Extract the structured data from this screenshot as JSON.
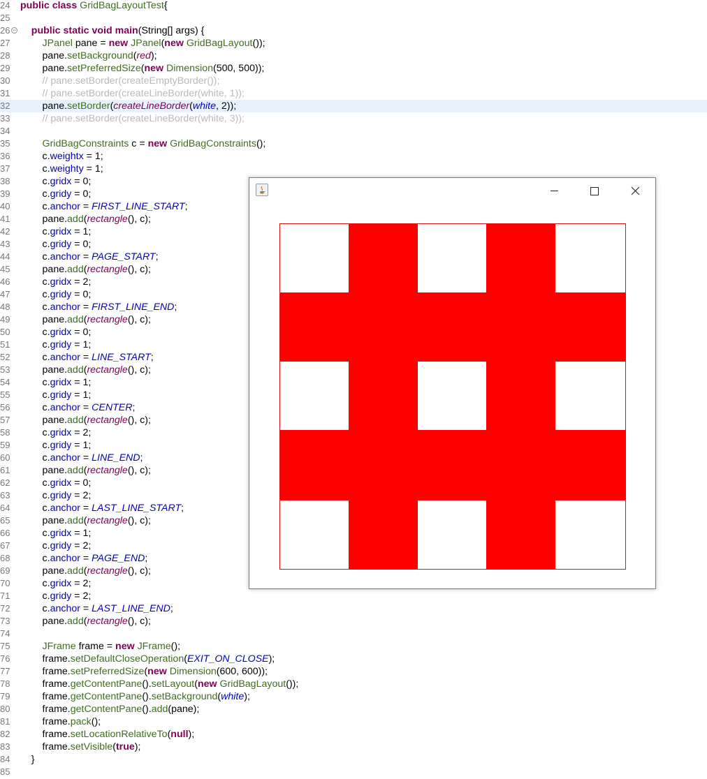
{
  "editor": {
    "lines": [
      {
        "n": "24",
        "t": [
          [
            "kw",
            "public class "
          ],
          [
            "ty",
            "GridBagLayoutTest"
          ],
          [
            "",
            "{"
          ]
        ]
      },
      {
        "n": "25",
        "t": []
      },
      {
        "n": "26",
        "fold": true,
        "t": [
          [
            "",
            "    "
          ],
          [
            "kw",
            "public static void "
          ],
          [
            "kw",
            "main"
          ],
          [
            "",
            "(String[] args) {"
          ]
        ]
      },
      {
        "n": "27",
        "t": [
          [
            "",
            "        "
          ],
          [
            "ty",
            "JPanel"
          ],
          [
            "",
            " pane = "
          ],
          [
            "kw",
            "new "
          ],
          [
            "ty",
            "JPanel"
          ],
          [
            "",
            "("
          ],
          [
            "kw",
            "new "
          ],
          [
            "ty",
            "GridBagLayout"
          ],
          [
            "",
            "());"
          ]
        ]
      },
      {
        "n": "28",
        "t": [
          [
            "",
            "        pane."
          ],
          [
            "me",
            "setBackground"
          ],
          [
            "",
            "("
          ],
          [
            "im",
            "red"
          ],
          [
            "",
            ");"
          ]
        ]
      },
      {
        "n": "29",
        "t": [
          [
            "",
            "        pane."
          ],
          [
            "me",
            "setPreferredSize"
          ],
          [
            "",
            "("
          ],
          [
            "kw",
            "new "
          ],
          [
            "ty",
            "Dimension"
          ],
          [
            "",
            "(500, 500));"
          ]
        ]
      },
      {
        "n": "30",
        "t": [
          [
            "cm",
            "        // pane.setBorder(createEmptyBorder());"
          ]
        ]
      },
      {
        "n": "31",
        "t": [
          [
            "cm",
            "        // pane.setBorder(createLineBorder(white, 1));"
          ]
        ]
      },
      {
        "n": "32",
        "current": true,
        "t": [
          [
            "",
            "        pane."
          ],
          [
            "me",
            "setBorder"
          ],
          [
            "",
            "("
          ],
          [
            "im",
            "createLineBorder"
          ],
          [
            "",
            "("
          ],
          [
            "it",
            "white"
          ],
          [
            "",
            ", 2));"
          ]
        ]
      },
      {
        "n": "33",
        "t": [
          [
            "cm",
            "        // pane.setBorder(createLineBorder(white, 3));"
          ]
        ]
      },
      {
        "n": "34",
        "t": []
      },
      {
        "n": "35",
        "t": [
          [
            "",
            "        "
          ],
          [
            "ty",
            "GridBagConstraints"
          ],
          [
            "",
            " c = "
          ],
          [
            "kw",
            "new "
          ],
          [
            "ty",
            "GridBagConstraints"
          ],
          [
            "",
            "();"
          ]
        ]
      },
      {
        "n": "36",
        "t": [
          [
            "",
            "        c."
          ],
          [
            "fi",
            "weightx"
          ],
          [
            "",
            " = 1;"
          ]
        ]
      },
      {
        "n": "37",
        "t": [
          [
            "",
            "        c."
          ],
          [
            "fi",
            "weighty"
          ],
          [
            "",
            " = 1;"
          ]
        ]
      },
      {
        "n": "38",
        "t": [
          [
            "",
            "        c."
          ],
          [
            "fi",
            "gridx"
          ],
          [
            "",
            " = 0;"
          ]
        ]
      },
      {
        "n": "39",
        "t": [
          [
            "",
            "        c."
          ],
          [
            "fi",
            "gridy"
          ],
          [
            "",
            " = 0;"
          ]
        ]
      },
      {
        "n": "40",
        "t": [
          [
            "",
            "        c."
          ],
          [
            "fi",
            "anchor"
          ],
          [
            "",
            " = "
          ],
          [
            "it",
            "FIRST_LINE_START"
          ],
          [
            "",
            ";"
          ]
        ]
      },
      {
        "n": "41",
        "t": [
          [
            "",
            "        pane."
          ],
          [
            "me",
            "add"
          ],
          [
            "",
            "("
          ],
          [
            "im",
            "rectangle"
          ],
          [
            "",
            "(), c);"
          ]
        ]
      },
      {
        "n": "42",
        "t": [
          [
            "",
            "        c."
          ],
          [
            "fi",
            "gridx"
          ],
          [
            "",
            " = 1;"
          ]
        ]
      },
      {
        "n": "43",
        "t": [
          [
            "",
            "        c."
          ],
          [
            "fi",
            "gridy"
          ],
          [
            "",
            " = 0;"
          ]
        ]
      },
      {
        "n": "44",
        "t": [
          [
            "",
            "        c."
          ],
          [
            "fi",
            "anchor"
          ],
          [
            "",
            " = "
          ],
          [
            "it",
            "PAGE_START"
          ],
          [
            "",
            ";"
          ]
        ]
      },
      {
        "n": "45",
        "t": [
          [
            "",
            "        pane."
          ],
          [
            "me",
            "add"
          ],
          [
            "",
            "("
          ],
          [
            "im",
            "rectangle"
          ],
          [
            "",
            "(), c);"
          ]
        ]
      },
      {
        "n": "46",
        "t": [
          [
            "",
            "        c."
          ],
          [
            "fi",
            "gridx"
          ],
          [
            "",
            " = 2;"
          ]
        ]
      },
      {
        "n": "47",
        "t": [
          [
            "",
            "        c."
          ],
          [
            "fi",
            "gridy"
          ],
          [
            "",
            " = 0;"
          ]
        ]
      },
      {
        "n": "48",
        "t": [
          [
            "",
            "        c."
          ],
          [
            "fi",
            "anchor"
          ],
          [
            "",
            " = "
          ],
          [
            "it",
            "FIRST_LINE_END"
          ],
          [
            "",
            ";"
          ]
        ]
      },
      {
        "n": "49",
        "t": [
          [
            "",
            "        pane."
          ],
          [
            "me",
            "add"
          ],
          [
            "",
            "("
          ],
          [
            "im",
            "rectangle"
          ],
          [
            "",
            "(), c);"
          ]
        ]
      },
      {
        "n": "50",
        "t": [
          [
            "",
            "        c."
          ],
          [
            "fi",
            "gridx"
          ],
          [
            "",
            " = 0;"
          ]
        ]
      },
      {
        "n": "51",
        "t": [
          [
            "",
            "        c."
          ],
          [
            "fi",
            "gridy"
          ],
          [
            "",
            " = 1;"
          ]
        ]
      },
      {
        "n": "52",
        "t": [
          [
            "",
            "        c."
          ],
          [
            "fi",
            "anchor"
          ],
          [
            "",
            " = "
          ],
          [
            "it",
            "LINE_START"
          ],
          [
            "",
            ";"
          ]
        ]
      },
      {
        "n": "53",
        "t": [
          [
            "",
            "        pane."
          ],
          [
            "me",
            "add"
          ],
          [
            "",
            "("
          ],
          [
            "im",
            "rectangle"
          ],
          [
            "",
            "(), c);"
          ]
        ]
      },
      {
        "n": "54",
        "t": [
          [
            "",
            "        c."
          ],
          [
            "fi",
            "gridx"
          ],
          [
            "",
            " = 1;"
          ]
        ]
      },
      {
        "n": "55",
        "t": [
          [
            "",
            "        c."
          ],
          [
            "fi",
            "gridy"
          ],
          [
            "",
            " = 1;"
          ]
        ]
      },
      {
        "n": "56",
        "t": [
          [
            "",
            "        c."
          ],
          [
            "fi",
            "anchor"
          ],
          [
            "",
            " = "
          ],
          [
            "it",
            "CENTER"
          ],
          [
            "",
            ";"
          ]
        ]
      },
      {
        "n": "57",
        "t": [
          [
            "",
            "        pane."
          ],
          [
            "me",
            "add"
          ],
          [
            "",
            "("
          ],
          [
            "im",
            "rectangle"
          ],
          [
            "",
            "(), c);"
          ]
        ]
      },
      {
        "n": "58",
        "t": [
          [
            "",
            "        c."
          ],
          [
            "fi",
            "gridx"
          ],
          [
            "",
            " = 2;"
          ]
        ]
      },
      {
        "n": "59",
        "t": [
          [
            "",
            "        c."
          ],
          [
            "fi",
            "gridy"
          ],
          [
            "",
            " = 1;"
          ]
        ]
      },
      {
        "n": "60",
        "t": [
          [
            "",
            "        c."
          ],
          [
            "fi",
            "anchor"
          ],
          [
            "",
            " = "
          ],
          [
            "it",
            "LINE_END"
          ],
          [
            "",
            ";"
          ]
        ]
      },
      {
        "n": "61",
        "t": [
          [
            "",
            "        pane."
          ],
          [
            "me",
            "add"
          ],
          [
            "",
            "("
          ],
          [
            "im",
            "rectangle"
          ],
          [
            "",
            "(), c);"
          ]
        ]
      },
      {
        "n": "62",
        "t": [
          [
            "",
            "        c."
          ],
          [
            "fi",
            "gridx"
          ],
          [
            "",
            " = 0;"
          ]
        ]
      },
      {
        "n": "63",
        "t": [
          [
            "",
            "        c."
          ],
          [
            "fi",
            "gridy"
          ],
          [
            "",
            " = 2;"
          ]
        ]
      },
      {
        "n": "64",
        "t": [
          [
            "",
            "        c."
          ],
          [
            "fi",
            "anchor"
          ],
          [
            "",
            " = "
          ],
          [
            "it",
            "LAST_LINE_START"
          ],
          [
            "",
            ";"
          ]
        ]
      },
      {
        "n": "65",
        "t": [
          [
            "",
            "        pane."
          ],
          [
            "me",
            "add"
          ],
          [
            "",
            "("
          ],
          [
            "im",
            "rectangle"
          ],
          [
            "",
            "(), c);"
          ]
        ]
      },
      {
        "n": "66",
        "t": [
          [
            "",
            "        c."
          ],
          [
            "fi",
            "gridx"
          ],
          [
            "",
            " = 1;"
          ]
        ]
      },
      {
        "n": "67",
        "t": [
          [
            "",
            "        c."
          ],
          [
            "fi",
            "gridy"
          ],
          [
            "",
            " = 2;"
          ]
        ]
      },
      {
        "n": "68",
        "t": [
          [
            "",
            "        c."
          ],
          [
            "fi",
            "anchor"
          ],
          [
            "",
            " = "
          ],
          [
            "it",
            "PAGE_END"
          ],
          [
            "",
            ";"
          ]
        ]
      },
      {
        "n": "69",
        "t": [
          [
            "",
            "        pane."
          ],
          [
            "me",
            "add"
          ],
          [
            "",
            "("
          ],
          [
            "im",
            "rectangle"
          ],
          [
            "",
            "(), c);"
          ]
        ]
      },
      {
        "n": "70",
        "t": [
          [
            "",
            "        c."
          ],
          [
            "fi",
            "gridx"
          ],
          [
            "",
            " = 2;"
          ]
        ]
      },
      {
        "n": "71",
        "t": [
          [
            "",
            "        c."
          ],
          [
            "fi",
            "gridy"
          ],
          [
            "",
            " = 2;"
          ]
        ]
      },
      {
        "n": "72",
        "t": [
          [
            "",
            "        c."
          ],
          [
            "fi",
            "anchor"
          ],
          [
            "",
            " = "
          ],
          [
            "it",
            "LAST_LINE_END"
          ],
          [
            "",
            ";"
          ]
        ]
      },
      {
        "n": "73",
        "t": [
          [
            "",
            "        pane."
          ],
          [
            "me",
            "add"
          ],
          [
            "",
            "("
          ],
          [
            "im",
            "rectangle"
          ],
          [
            "",
            "(), c);"
          ]
        ]
      },
      {
        "n": "74",
        "t": []
      },
      {
        "n": "75",
        "t": [
          [
            "",
            "        "
          ],
          [
            "ty",
            "JFrame"
          ],
          [
            "",
            " frame = "
          ],
          [
            "kw",
            "new "
          ],
          [
            "ty",
            "JFrame"
          ],
          [
            "",
            "();"
          ]
        ]
      },
      {
        "n": "76",
        "t": [
          [
            "",
            "        frame."
          ],
          [
            "me",
            "setDefaultCloseOperation"
          ],
          [
            "",
            "("
          ],
          [
            "it",
            "EXIT_ON_CLOSE"
          ],
          [
            "",
            ");"
          ]
        ]
      },
      {
        "n": "77",
        "t": [
          [
            "",
            "        frame."
          ],
          [
            "me",
            "setPreferredSize"
          ],
          [
            "",
            "("
          ],
          [
            "kw",
            "new "
          ],
          [
            "ty",
            "Dimension"
          ],
          [
            "",
            "(600, 600));"
          ]
        ]
      },
      {
        "n": "78",
        "t": [
          [
            "",
            "        frame."
          ],
          [
            "me",
            "getContentPane"
          ],
          [
            "",
            "()."
          ],
          [
            "me",
            "setLayout"
          ],
          [
            "",
            "("
          ],
          [
            "kw",
            "new "
          ],
          [
            "ty",
            "GridBagLayout"
          ],
          [
            "",
            "());"
          ]
        ]
      },
      {
        "n": "79",
        "t": [
          [
            "",
            "        frame."
          ],
          [
            "me",
            "getContentPane"
          ],
          [
            "",
            "()."
          ],
          [
            "me",
            "setBackground"
          ],
          [
            "",
            "("
          ],
          [
            "it",
            "white"
          ],
          [
            "",
            ");"
          ]
        ]
      },
      {
        "n": "80",
        "t": [
          [
            "",
            "        frame."
          ],
          [
            "me",
            "getContentPane"
          ],
          [
            "",
            "()."
          ],
          [
            "me",
            "add"
          ],
          [
            "",
            "(pane);"
          ]
        ]
      },
      {
        "n": "81",
        "t": [
          [
            "",
            "        frame."
          ],
          [
            "me",
            "pack"
          ],
          [
            "",
            "();"
          ]
        ]
      },
      {
        "n": "82",
        "t": [
          [
            "",
            "        frame."
          ],
          [
            "me",
            "setLocationRelativeTo"
          ],
          [
            "",
            "("
          ],
          [
            "kw",
            "null"
          ],
          [
            "",
            ");"
          ]
        ]
      },
      {
        "n": "83",
        "t": [
          [
            "",
            "        frame."
          ],
          [
            "me",
            "setVisible"
          ],
          [
            "",
            "("
          ],
          [
            "kw",
            "true"
          ],
          [
            "",
            ");"
          ]
        ]
      },
      {
        "n": "84",
        "t": [
          [
            "",
            "    }"
          ]
        ]
      },
      {
        "n": "85",
        "t": []
      }
    ]
  },
  "window": {
    "icon": "java-app-icon",
    "buttons": {
      "minimize": "─",
      "maximize": "☐",
      "close": "✕"
    },
    "panel_color": "#ff0000",
    "background_color": "#ffffff"
  }
}
